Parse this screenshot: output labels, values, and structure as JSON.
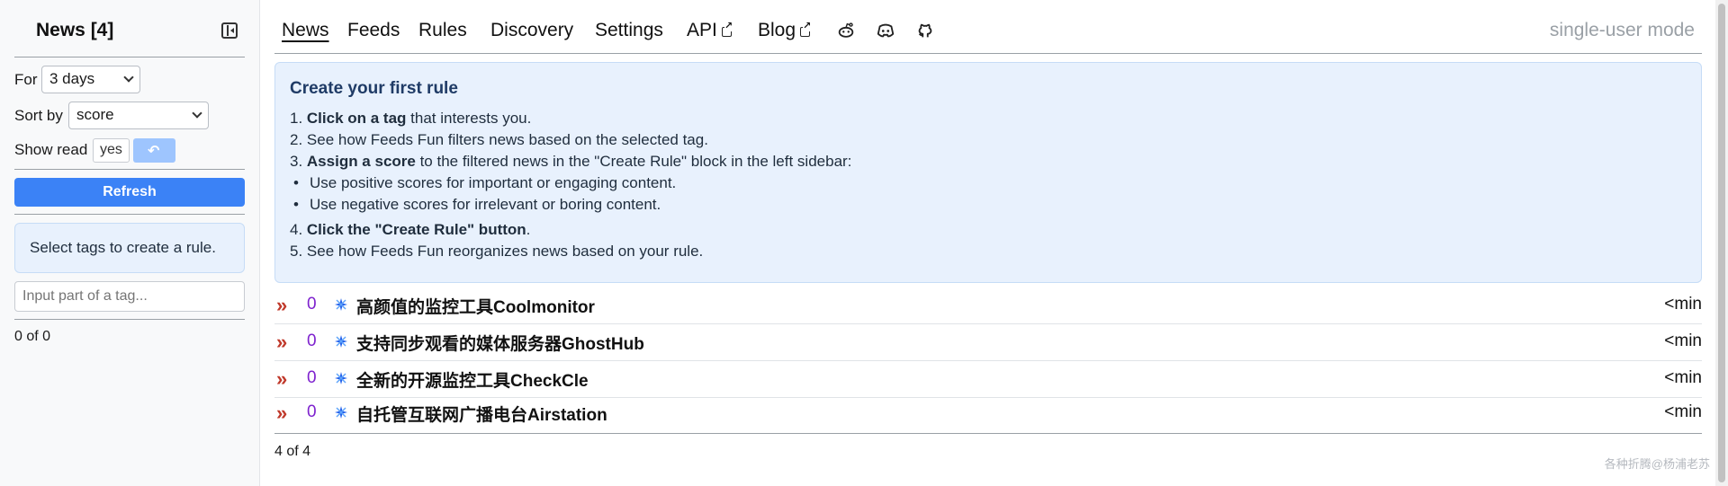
{
  "sidebar": {
    "title": "News [4]",
    "period_label": "For",
    "period_value": "3 days",
    "sort_label": "Sort by",
    "sort_value": "score",
    "show_read_label": "Show read",
    "show_read_value": "yes",
    "undo_icon": "undo-icon",
    "refresh_label": "Refresh",
    "rule_hint": "Select tags to create a rule.",
    "tag_placeholder": "Input part of a tag...",
    "count": "0 of 0"
  },
  "nav": {
    "items": [
      "News",
      "Feeds",
      "Rules",
      "Discovery",
      "Settings",
      "API",
      "Blog"
    ],
    "active": "News",
    "icons": [
      "reddit-icon",
      "discord-icon",
      "github-icon"
    ],
    "mode": "single-user mode"
  },
  "info": {
    "title": "Create your first rule",
    "step1_bold": "Click on a tag",
    "step1_rest": " that interests you.",
    "step1_num": "1. ",
    "step2": "2. See how Feeds Fun filters news based on the selected tag.",
    "step3_num": "3. ",
    "step3_bold": "Assign a score",
    "step3_rest": " to the filtered news in the \"Create Rule\" block in the left sidebar:",
    "bullet1": "Use positive scores for important or engaging content.",
    "bullet2": "Use negative scores for irrelevant or boring content.",
    "step4_num": "4. ",
    "step4_bold": "Click the \"Create Rule\" button",
    "step4_rest": ".",
    "step5": "5. See how Feeds Fun reorganizes news based on your rule."
  },
  "news": [
    {
      "arrow": "»",
      "score": "0",
      "title": "高颜值的监控工具Coolmonitor",
      "time": "<min"
    },
    {
      "arrow": "»",
      "score": "0",
      "title": "支持同步观看的媒体服务器GhostHub",
      "time": "<min"
    },
    {
      "arrow": "»",
      "score": "0",
      "title": "全新的开源监控工具CheckCle",
      "time": "<min"
    },
    {
      "arrow": "»",
      "score": "0",
      "title": "自托管互联网广播电台Airstation",
      "time": "<min"
    }
  ],
  "news_count": "4 of 4",
  "watermark": "各种折腾@杨浦老苏",
  "colors": {
    "accent": "#3b82f6",
    "info_bg": "#e8f1fd",
    "score": "#7e22ce",
    "arrow": "#c0392b",
    "mode": "#9aa0a6"
  }
}
